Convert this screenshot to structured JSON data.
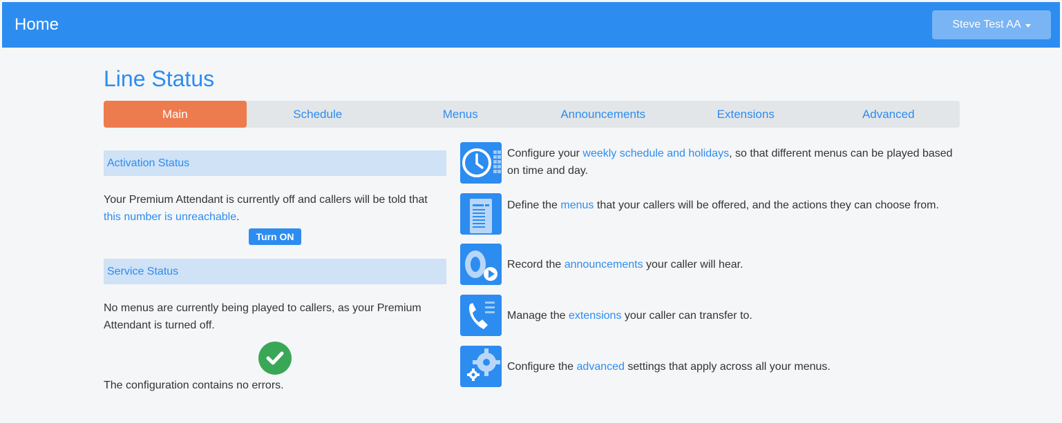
{
  "header": {
    "title": "Home",
    "user_menu_label": "Steve Test AA"
  },
  "page": {
    "title": "Line Status"
  },
  "tabs": [
    {
      "label": "Main",
      "active": true
    },
    {
      "label": "Schedule",
      "active": false
    },
    {
      "label": "Menus",
      "active": false
    },
    {
      "label": "Announcements",
      "active": false
    },
    {
      "label": "Extensions",
      "active": false
    },
    {
      "label": "Advanced",
      "active": false
    }
  ],
  "activation": {
    "heading": "Activation Status",
    "text_before": "Your Premium Attendant is currently off and callers will be told that ",
    "link": "this number is unreachable",
    "text_after": ".",
    "button": "Turn ON"
  },
  "service": {
    "heading": "Service Status",
    "text": "No menus are currently being played to callers, as your Premium Attendant is turned off.",
    "check_icon": "check-circle-icon",
    "config_text": "The configuration contains no errors."
  },
  "features": [
    {
      "icon": "clock-calendar-icon",
      "before": "Configure your ",
      "link": "weekly schedule and holidays",
      "after": ", so that different menus can be played based on time and day."
    },
    {
      "icon": "menu-list-icon",
      "before": "Define the ",
      "link": "menus",
      "after": " that your callers will be offered, and the actions they can choose from."
    },
    {
      "icon": "speaker-play-icon",
      "before": "Record the ",
      "link": "announcements",
      "after": " your caller will hear."
    },
    {
      "icon": "phone-list-icon",
      "before": "Manage the ",
      "link": "extensions",
      "after": " your caller can transfer to."
    },
    {
      "icon": "gears-icon",
      "before": "Configure the ",
      "link": "advanced",
      "after": " settings that apply across all your menus."
    }
  ],
  "colors": {
    "primary": "#2d8cf0",
    "active_tab": "#ee7b4e",
    "section_bg": "#cfe2f6",
    "success": "#3aa757"
  }
}
